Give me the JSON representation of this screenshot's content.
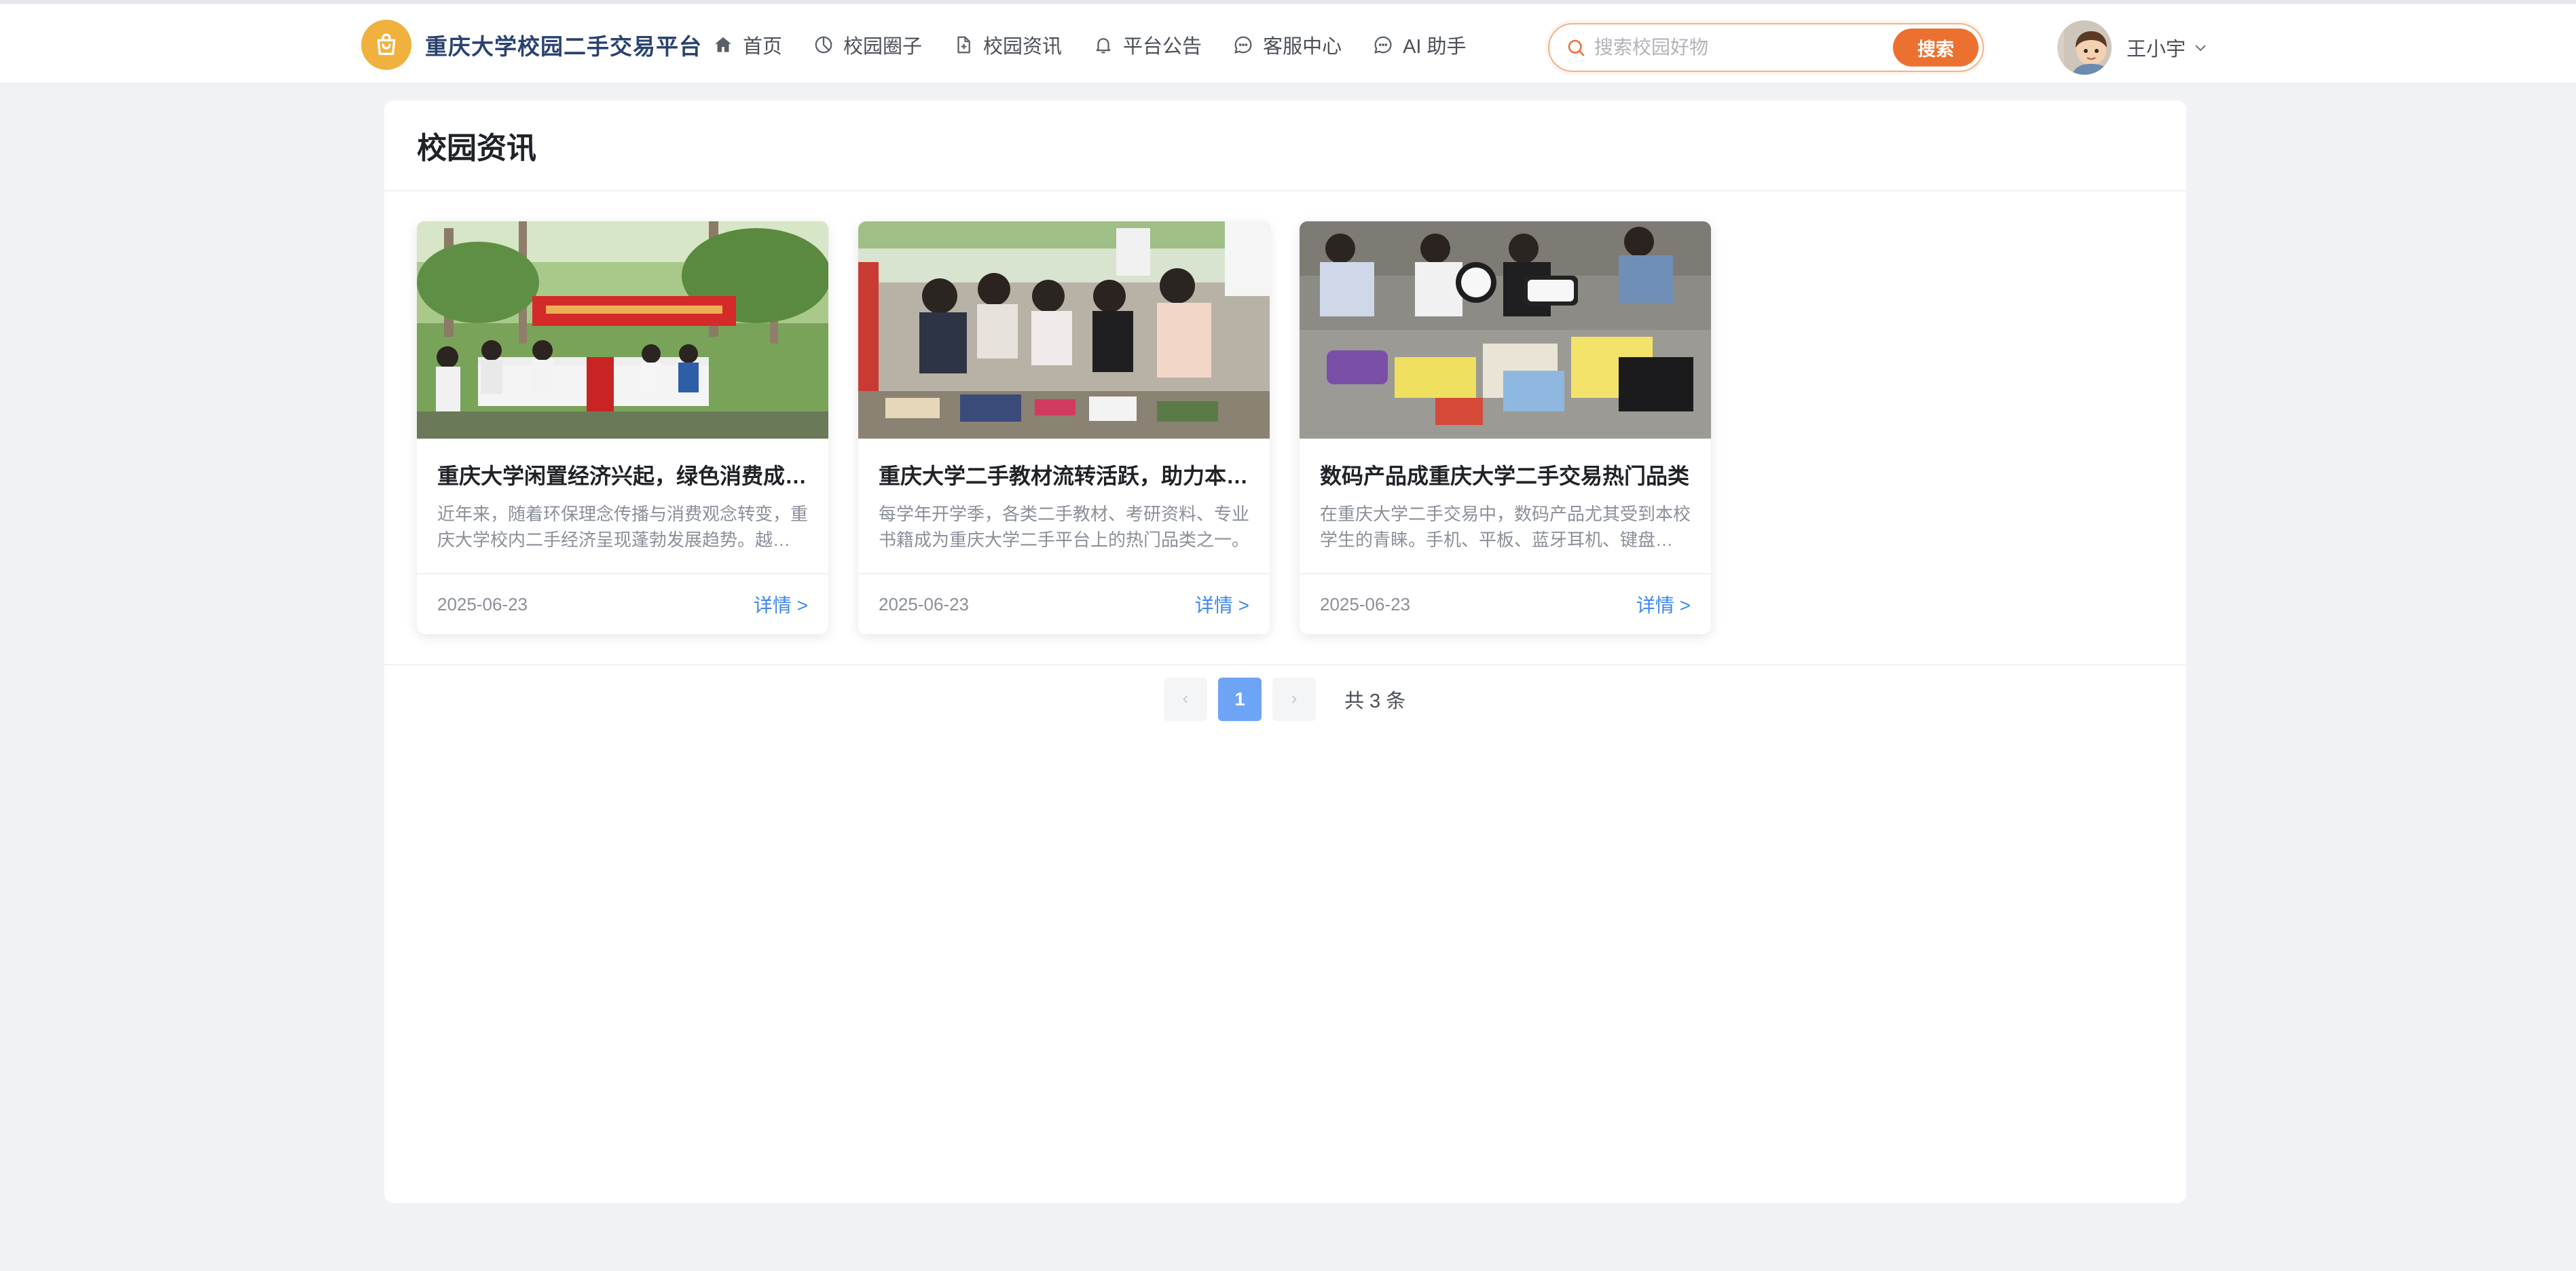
{
  "header": {
    "brand_title": "重庆大学校园二手交易平台",
    "nav": [
      {
        "label": "首页",
        "icon": "home-icon"
      },
      {
        "label": "校园圈子",
        "icon": "pie-chart-icon"
      },
      {
        "label": "校园资讯",
        "icon": "document-icon"
      },
      {
        "label": "平台公告",
        "icon": "bell-icon"
      },
      {
        "label": "客服中心",
        "icon": "chat-icon"
      },
      {
        "label": "AI 助手",
        "icon": "chat-icon"
      }
    ],
    "search": {
      "placeholder": "搜索校园好物",
      "button_label": "搜索"
    },
    "user": {
      "name": "王小宇"
    }
  },
  "colors": {
    "accent": "#ec7131",
    "brand_logo": "#f0b13e",
    "brand_text": "#2a4270",
    "link": "#3f86f0",
    "active_page": "#6ea4f5"
  },
  "main": {
    "title": "校园资讯",
    "cards": [
      {
        "title": "重庆大学闲置经济兴起，绿色消费成为新风尚",
        "desc": "近年来，随着环保理念传播与消费观念转变，重庆大学校内二手经济呈现蓬勃发展趋势。越来越多的同学选择闲置交易。",
        "date": "2025-06-23",
        "more": "详情 >",
        "image": "outdoor-booth-photo"
      },
      {
        "title": "重庆大学二手教材流转活跃，助力本科学习",
        "desc": "每学年开学季，各类二手教材、考研资料、专业书籍成为重庆大学二手平台上的热门品类之一。",
        "date": "2025-06-23",
        "more": "详情 >",
        "image": "students-market-photo"
      },
      {
        "title": "数码产品成重庆大学二手交易热门品类",
        "desc": "在重庆大学二手交易中，数码产品尤其受到本校学生的青睐。手机、平板、蓝牙耳机、键盘等备受欢迎。",
        "date": "2025-06-23",
        "more": "详情 >",
        "image": "flea-market-photo"
      }
    ]
  },
  "pagination": {
    "current": "1",
    "total_text": "共 3 条"
  }
}
